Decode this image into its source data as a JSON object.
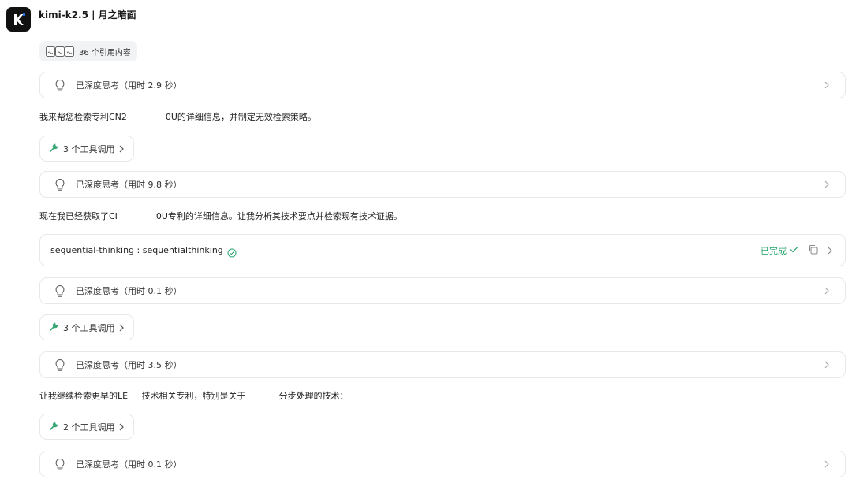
{
  "header": {
    "title": "kimi-k2.5 | 月之暗面"
  },
  "refs": {
    "label": "36 个引用内容"
  },
  "think1": {
    "label": "已深度思考（用时 2.9 秒）"
  },
  "msg1": {
    "text": "我来帮您检索专利CN2              0U的详细信息，并制定无效检索策略。"
  },
  "tool1": {
    "label": "3 个工具调用"
  },
  "think2": {
    "label": "已深度思考（用时 9.8 秒）"
  },
  "msg2": {
    "text": "现在我已经获取了CI              0U专利的详细信息。让我分析其技术要点并检索现有技术证据。"
  },
  "seq": {
    "name": "sequential-thinking : sequentialthinking",
    "status": "已完成"
  },
  "think3": {
    "label": "已深度思考（用时 0.1 秒）"
  },
  "tool2": {
    "label": "3 个工具调用"
  },
  "think4": {
    "label": "已深度思考（用时 3.5 秒）"
  },
  "msg3": {
    "text": "让我继续检索更早的LE     技术相关专利，特别是关于            分步处理的技术："
  },
  "tool3": {
    "label": "2 个工具调用"
  },
  "think5": {
    "label": "已深度思考（用时 0.1 秒）"
  },
  "colors": {
    "accent_green": "#23a36a",
    "border": "#e7e8eb",
    "text": "#1f1f1f"
  }
}
